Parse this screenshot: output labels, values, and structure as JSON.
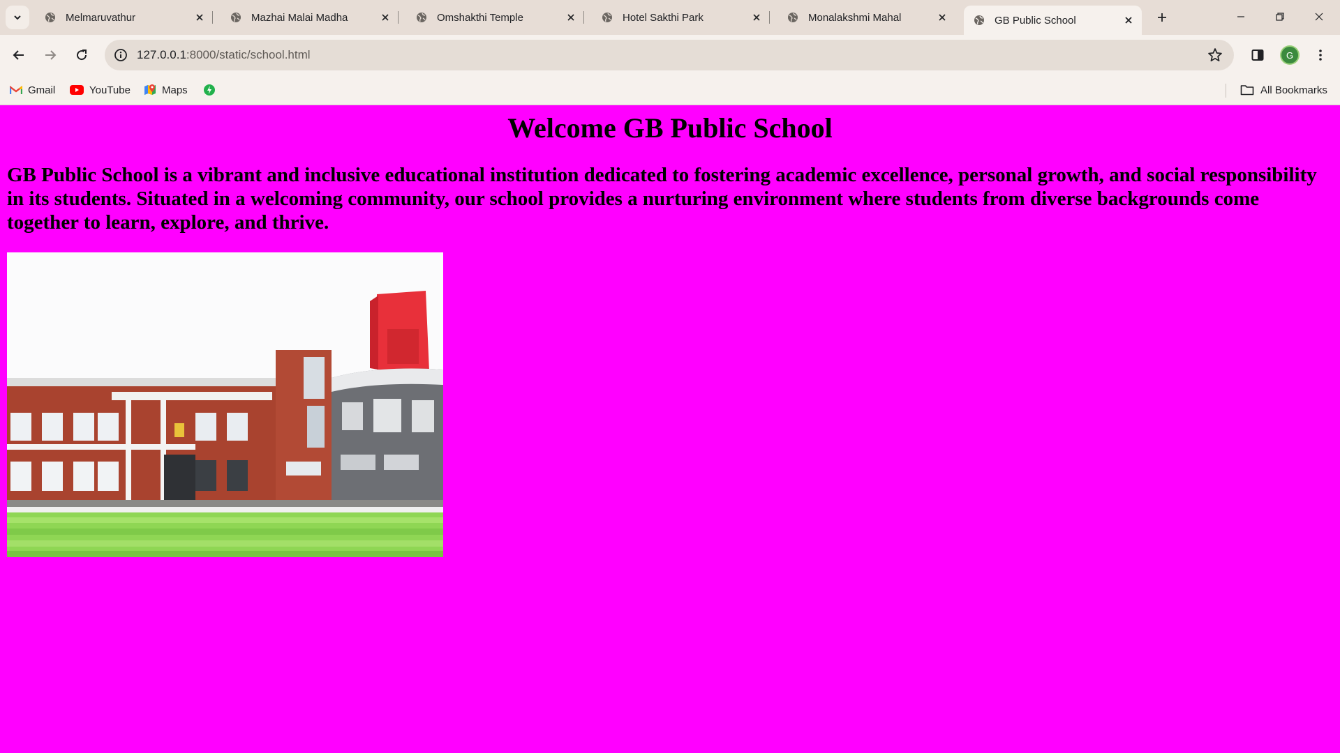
{
  "tabs": [
    {
      "title": "Melmaruvathur"
    },
    {
      "title": "Mazhai Malai Madha"
    },
    {
      "title": "Omshakthi Temple"
    },
    {
      "title": "Hotel Sakthi Park"
    },
    {
      "title": "Monalakshmi Mahal"
    },
    {
      "title": "GB Public School",
      "active": true
    }
  ],
  "address_bar": {
    "host": "127.0.0.1",
    "path": ":8000/static/school.html"
  },
  "profile": {
    "initial": "G"
  },
  "bookmarks": {
    "items": [
      {
        "label": "Gmail",
        "icon": "gmail-icon"
      },
      {
        "label": "YouTube",
        "icon": "youtube-icon"
      },
      {
        "label": "Maps",
        "icon": "maps-icon"
      },
      {
        "label": "",
        "icon": "green-bolt-icon"
      }
    ],
    "all_bookmarks": "All Bookmarks"
  },
  "page": {
    "heading": "Welcome GB Public School",
    "description": "GB Public School is a vibrant and inclusive educational institution dedicated to fostering academic excellence, personal growth, and social responsibility in its students. Situated in a welcoming community, our school provides a nurturing environment where students from diverse backgrounds come together to learn, explore, and thrive.",
    "background_color": "#ff00ff"
  }
}
